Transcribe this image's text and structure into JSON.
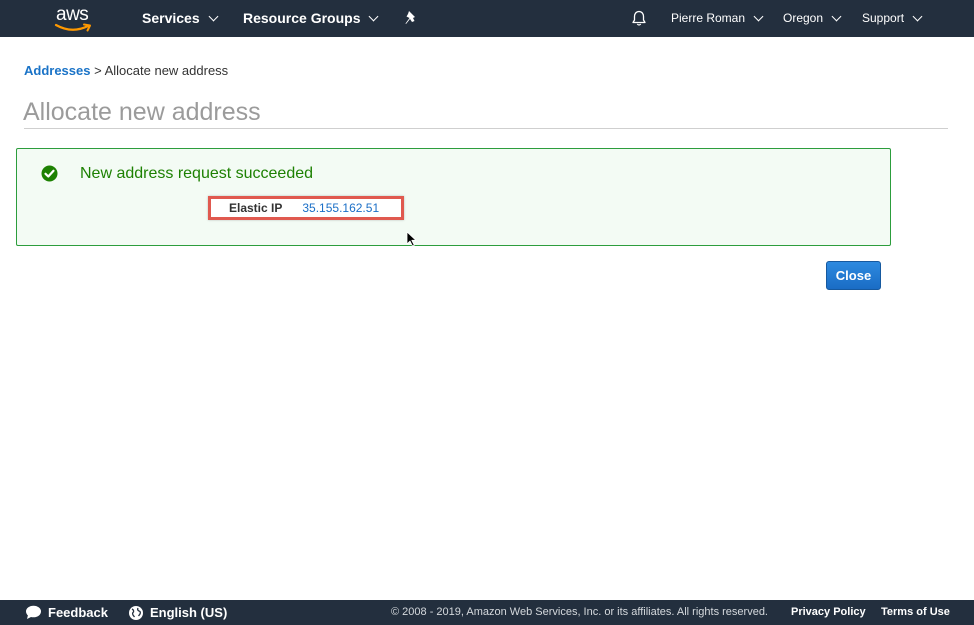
{
  "nav": {
    "logo_text": "aws",
    "services": "Services",
    "resource_groups": "Resource Groups",
    "user": "Pierre Roman",
    "region": "Oregon",
    "support": "Support"
  },
  "breadcrumb": {
    "parent": "Addresses",
    "separator": ">",
    "current": "Allocate new address"
  },
  "page": {
    "title": "Allocate new address"
  },
  "result": {
    "message": "New address request succeeded",
    "eip_label": "Elastic IP",
    "eip_value": "35.155.162.51"
  },
  "actions": {
    "close": "Close"
  },
  "footer": {
    "feedback": "Feedback",
    "language": "English (US)",
    "copyright": "© 2008 - 2019, Amazon Web Services, Inc. or its affiliates. All rights reserved.",
    "privacy": "Privacy Policy",
    "terms": "Terms of Use"
  },
  "colors": {
    "nav_bg": "#232f3e",
    "link": "#1a73c7",
    "success": "#1d8102",
    "highlight": "#e0594f",
    "primary_button": "#1a6cc5"
  },
  "icons": [
    "aws-logo",
    "chevron-down-icon",
    "pin-icon",
    "bell-icon",
    "check-circle-icon",
    "cursor-icon",
    "speech-bubble-icon",
    "globe-icon"
  ]
}
